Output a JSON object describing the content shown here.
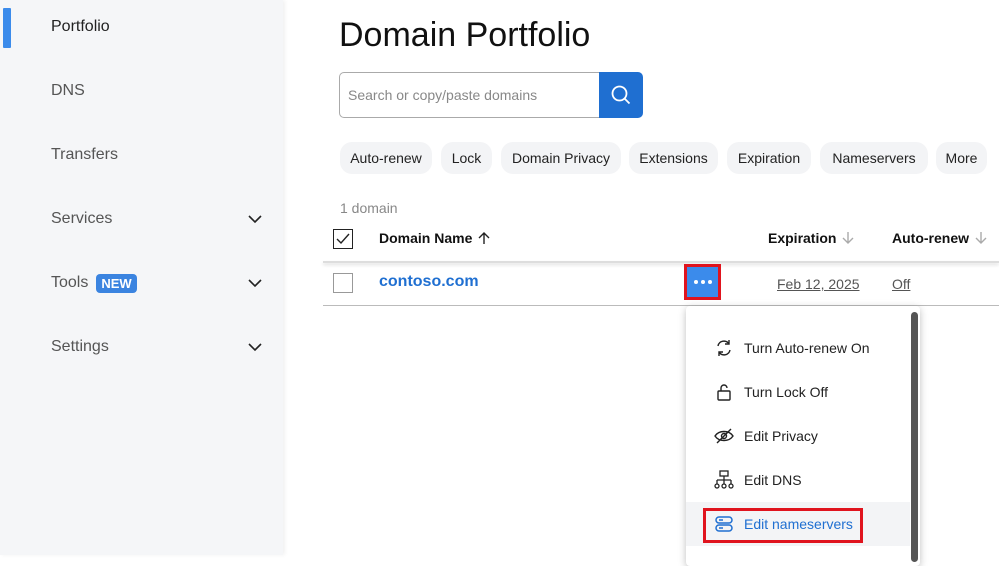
{
  "sidebar": {
    "items": [
      {
        "label": "Portfolio",
        "active": true
      },
      {
        "label": "DNS"
      },
      {
        "label": "Transfers"
      },
      {
        "label": "Services",
        "expandable": true
      },
      {
        "label": "Tools",
        "badge": "NEW",
        "expandable": true
      },
      {
        "label": "Settings",
        "expandable": true
      }
    ]
  },
  "header": {
    "title": "Domain Portfolio"
  },
  "search": {
    "placeholder": "Search or copy/paste domains",
    "icon": "search-icon"
  },
  "filters": [
    "Auto-renew",
    "Lock",
    "Domain Privacy",
    "Extensions",
    "Expiration",
    "Nameservers",
    "More"
  ],
  "table": {
    "count": "1 domain",
    "columns": {
      "domain": "Domain Name",
      "expiration": "Expiration",
      "autorenew": "Auto-renew"
    },
    "rows": [
      {
        "domain": "contoso.com",
        "expiration": "Feb 12, 2025",
        "autorenew": "Off"
      }
    ]
  },
  "menu": {
    "items": [
      {
        "label": "Turn Auto-renew On",
        "icon": "refresh-icon"
      },
      {
        "label": "Turn Lock Off",
        "icon": "unlock-icon"
      },
      {
        "label": "Edit Privacy",
        "icon": "eye-off-icon"
      },
      {
        "label": "Edit DNS",
        "icon": "sitemap-icon"
      },
      {
        "label": "Edit nameservers",
        "icon": "server-icon",
        "highlighted": true
      }
    ]
  },
  "colors": {
    "accent": "#1f6fd1",
    "highlight_box": "#e0141e"
  }
}
